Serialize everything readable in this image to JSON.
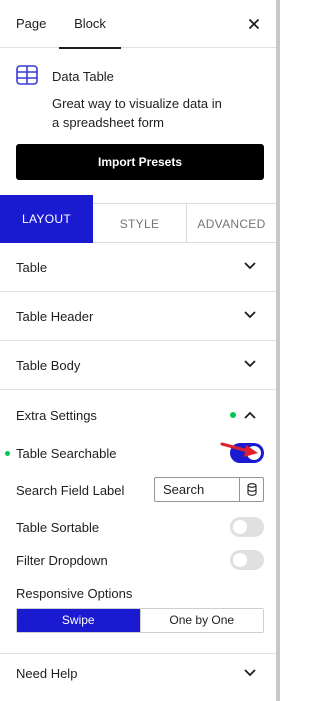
{
  "header": {
    "tabs": [
      "Page",
      "Block"
    ],
    "active_tab": "Block",
    "close_icon": "close-icon"
  },
  "block": {
    "icon": "table-grid-icon",
    "title": "Data Table",
    "description": "Great way to visualize data in a spreadsheet form",
    "import_button": "Import Presets"
  },
  "mode_tabs": {
    "layout": "LAYOUT",
    "style": "STYLE",
    "advanced": "ADVANCED",
    "active": "LAYOUT"
  },
  "sections": {
    "table": "Table",
    "table_header": "Table Header",
    "table_body": "Table Body",
    "extra_settings": "Extra Settings",
    "need_help": "Need Help"
  },
  "extra_settings": {
    "expanded": true,
    "table_searchable": {
      "label": "Table Searchable",
      "enabled": true
    },
    "search_field_label": {
      "label": "Search Field Label",
      "value": "Search",
      "icon": "database-icon"
    },
    "table_sortable": {
      "label": "Table Sortable",
      "enabled": false
    },
    "filter_dropdown": {
      "label": "Filter Dropdown",
      "enabled": false
    },
    "responsive_options": {
      "label": "Responsive Options",
      "options": [
        "Swipe",
        "One by One"
      ],
      "selected": "Swipe"
    }
  },
  "colors": {
    "accent": "#1a1ad1",
    "modified_dot": "#00c853",
    "annotation_arrow": "#e0202a",
    "button_dark": "#000000"
  }
}
